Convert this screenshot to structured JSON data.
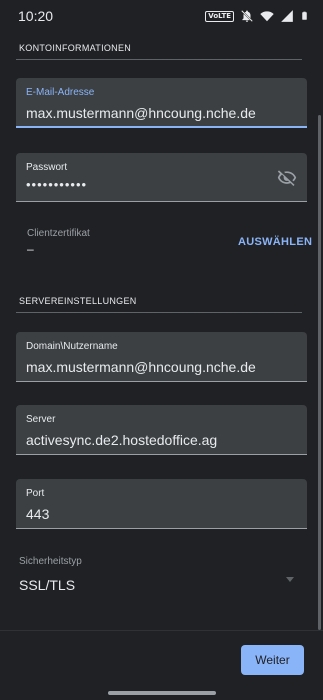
{
  "status": {
    "time": "10:20",
    "network_badge": "VoLTE"
  },
  "account": {
    "section_title": "KONTOINFORMATIONEN",
    "email": {
      "label": "E-Mail-Adresse",
      "value": "max.mustermann@hncoung.nche.de"
    },
    "password": {
      "label": "Passwort",
      "value": "•••••••••••"
    },
    "certificate": {
      "label": "Clientzertifikat",
      "value": "–",
      "action": "AUSWÄHLEN"
    }
  },
  "server": {
    "section_title": "SERVEREINSTELLUNGEN",
    "domain_user": {
      "label": "Domain\\Nutzername",
      "value": "max.mustermann@hncoung.nche.de"
    },
    "server": {
      "label": "Server",
      "value": "activesync.de2.hostedoffice.ag"
    },
    "port": {
      "label": "Port",
      "value": "443"
    },
    "security": {
      "label": "Sicherheitstyp",
      "value": "SSL/TLS"
    }
  },
  "footer": {
    "next_label": "Weiter"
  },
  "colors": {
    "accent": "#8ab4f8",
    "background": "#202124",
    "field": "#3c4043"
  }
}
